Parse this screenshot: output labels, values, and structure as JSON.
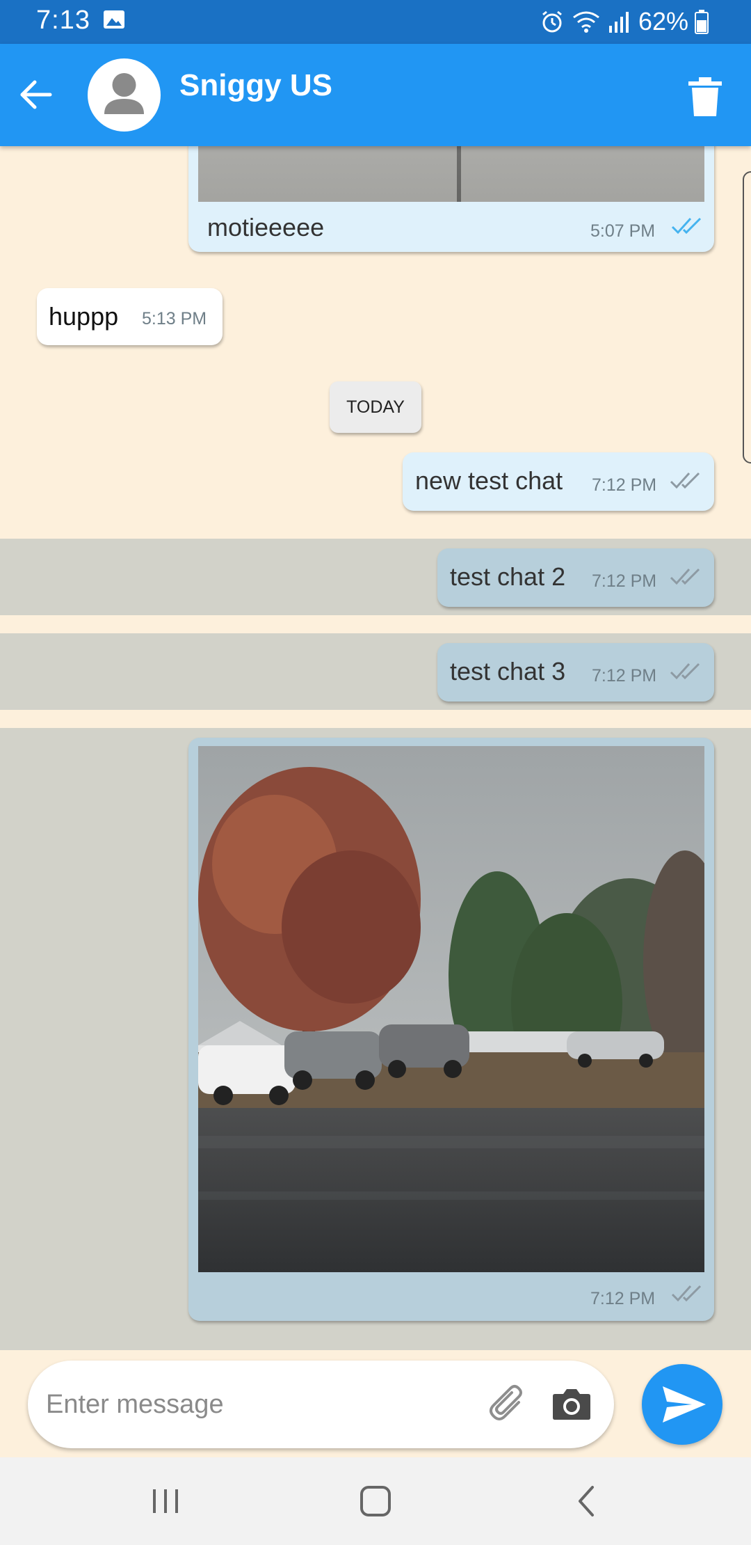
{
  "status_bar": {
    "time": "7:13",
    "battery": "62%",
    "icons": [
      "gallery-icon",
      "alarm-icon",
      "wifi-icon",
      "signal-icon",
      "battery-icon"
    ]
  },
  "header": {
    "contact_name": "Sniggy US",
    "icons": [
      "back-arrow-icon",
      "avatar-person-icon",
      "trash-icon"
    ]
  },
  "messages": [
    {
      "type": "image",
      "direction": "out",
      "caption": "motieeeee",
      "time": "5:07 PM",
      "status": "read"
    },
    {
      "type": "text",
      "direction": "in",
      "text": "huppp",
      "time": "5:13 PM"
    },
    {
      "type": "date",
      "label": "TODAY"
    },
    {
      "type": "text",
      "direction": "out",
      "text": "new test chat",
      "time": "7:12 PM",
      "status": "delivered"
    },
    {
      "type": "text",
      "direction": "out",
      "text": "test chat 2",
      "time": "7:12 PM",
      "status": "delivered",
      "selected": true
    },
    {
      "type": "text",
      "direction": "out",
      "text": "test chat 3",
      "time": "7:12 PM",
      "status": "delivered",
      "selected": true
    },
    {
      "type": "image",
      "direction": "out",
      "time": "7:12 PM",
      "status": "delivered",
      "selected": true
    }
  ],
  "composer": {
    "placeholder": "Enter message",
    "icons": [
      "paperclip-icon",
      "camera-icon",
      "send-icon"
    ]
  },
  "colors": {
    "app_bar": "#2196f3",
    "status_bar": "#1a71c4",
    "chat_background": "#fdf0dc",
    "outgoing_bubble": "#dff1fb",
    "selected_bubble": "#b7cfdb",
    "selection_band": "#d2d2c9",
    "read_tick": "#45b3ef",
    "delivered_tick": "#8d9aa3"
  }
}
